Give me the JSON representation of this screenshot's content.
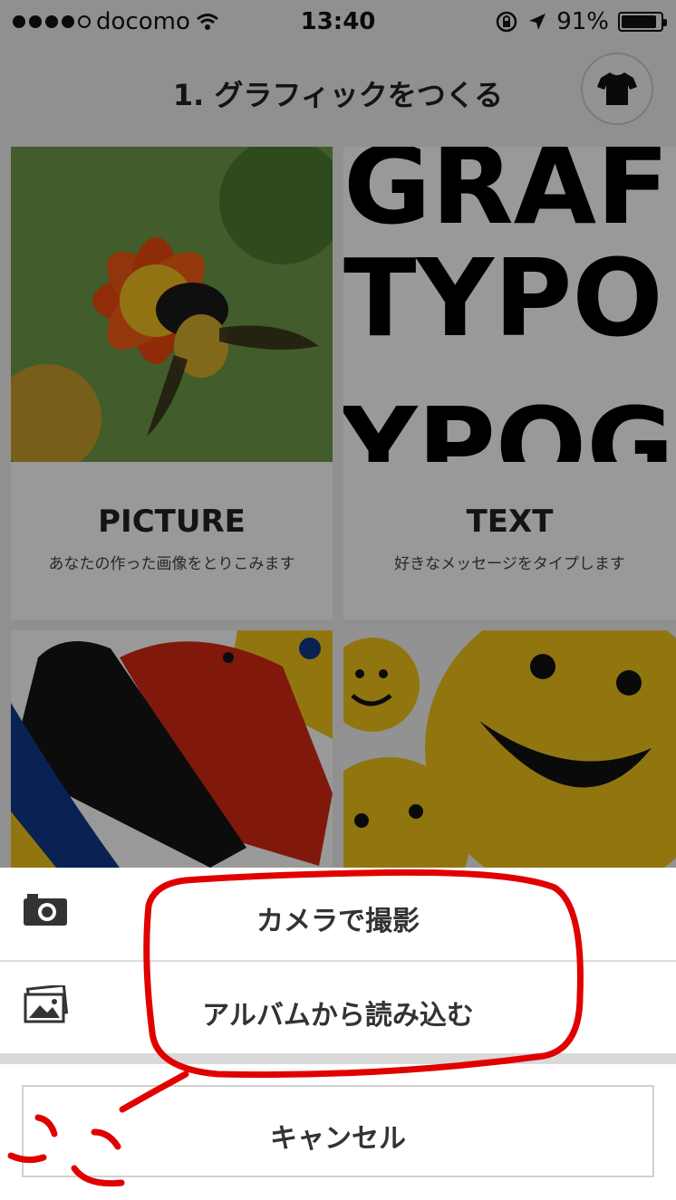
{
  "status_bar": {
    "carrier": "docomo",
    "time": "13:40",
    "battery_percent": "91%",
    "battery_level": 0.91,
    "signal_dots_filled": 4,
    "signal_dots_total": 5
  },
  "header": {
    "title": "1. グラフィックをつくる",
    "shirt_icon": "tshirt-icon"
  },
  "cards": [
    {
      "label": "PICTURE",
      "description": "あなたの作った画像をとりこみます",
      "image": "flower-bee-photo"
    },
    {
      "label": "TEXT",
      "description": "好きなメッセージをタイプします",
      "image": "typography-sample"
    },
    {
      "label": "",
      "description": "",
      "image": "paint-splash-art"
    },
    {
      "label": "",
      "description": "",
      "image": "smiley-faces-art"
    }
  ],
  "text_card_image_lines": [
    "GRAF",
    "TYPO",
    "YPOGI"
  ],
  "action_sheet": {
    "camera_label": "カメラで撮影",
    "album_label": "アルバムから読み込む",
    "cancel_label": "キャンセル",
    "camera_icon": "camera-icon",
    "album_icon": "photo-album-icon"
  },
  "colors": {
    "annotation_red": "#e00000",
    "background": "#f1f1f1",
    "overlay": "rgba(0,0,0,0.40)"
  }
}
